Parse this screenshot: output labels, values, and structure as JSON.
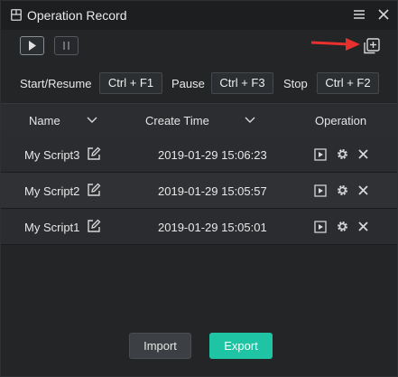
{
  "window": {
    "title": "Operation Record"
  },
  "toolbar": {
    "play_icon": "play-icon",
    "pause_icon": "pause-icon",
    "new_icon": "add-record-icon",
    "annotation_arrow_color": "#e8312f"
  },
  "hotkeys": {
    "start_label": "Start/Resume",
    "start_key": "Ctrl + F1",
    "pause_label": "Pause",
    "pause_key": "Ctrl + F3",
    "stop_label": "Stop",
    "stop_key": "Ctrl + F2"
  },
  "table": {
    "headers": {
      "name": "Name",
      "create_time": "Create Time",
      "operation": "Operation"
    },
    "rows": [
      {
        "name": "My Script3",
        "time": "2019-01-29 15:06:23"
      },
      {
        "name": "My Script2",
        "time": "2019-01-29 15:05:57"
      },
      {
        "name": "My Script1",
        "time": "2019-01-29 15:05:01"
      }
    ]
  },
  "footer": {
    "import_label": "Import",
    "export_label": "Export"
  },
  "colors": {
    "accent": "#1ec4a4",
    "background": "#232527"
  }
}
